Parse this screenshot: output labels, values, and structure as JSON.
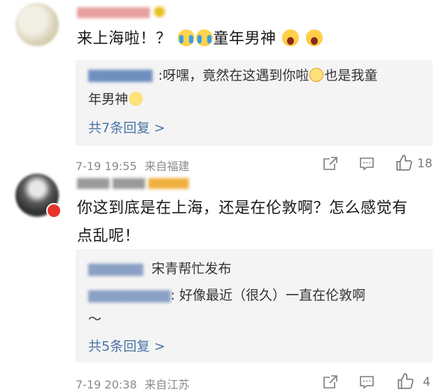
{
  "comment1": {
    "text_before": "来上海啦！？",
    "text_after": "童年男神",
    "reply": {
      "text1": ":呀嘿，竟然在这遇到你啦",
      "text2": "也是我童",
      "text3": "年男神",
      "more_link": "共7条回复 >"
    },
    "timestamp": "7-19 19:55",
    "location": "来自福建",
    "like_count": "18"
  },
  "comment2": {
    "text_line1": "你这到底是在上海，还是在伦敦啊？怎么感觉有",
    "text_line2": "点乱呢！",
    "reply1_text": "宋青帮忙发布",
    "reply2_text": ": 好像最近（很久）一直在伦敦啊",
    "reply2_text_cont": "～",
    "more_link": "共5条回复 >",
    "timestamp": "7-19 20:38",
    "location": "来自江苏",
    "like_count": "4"
  }
}
